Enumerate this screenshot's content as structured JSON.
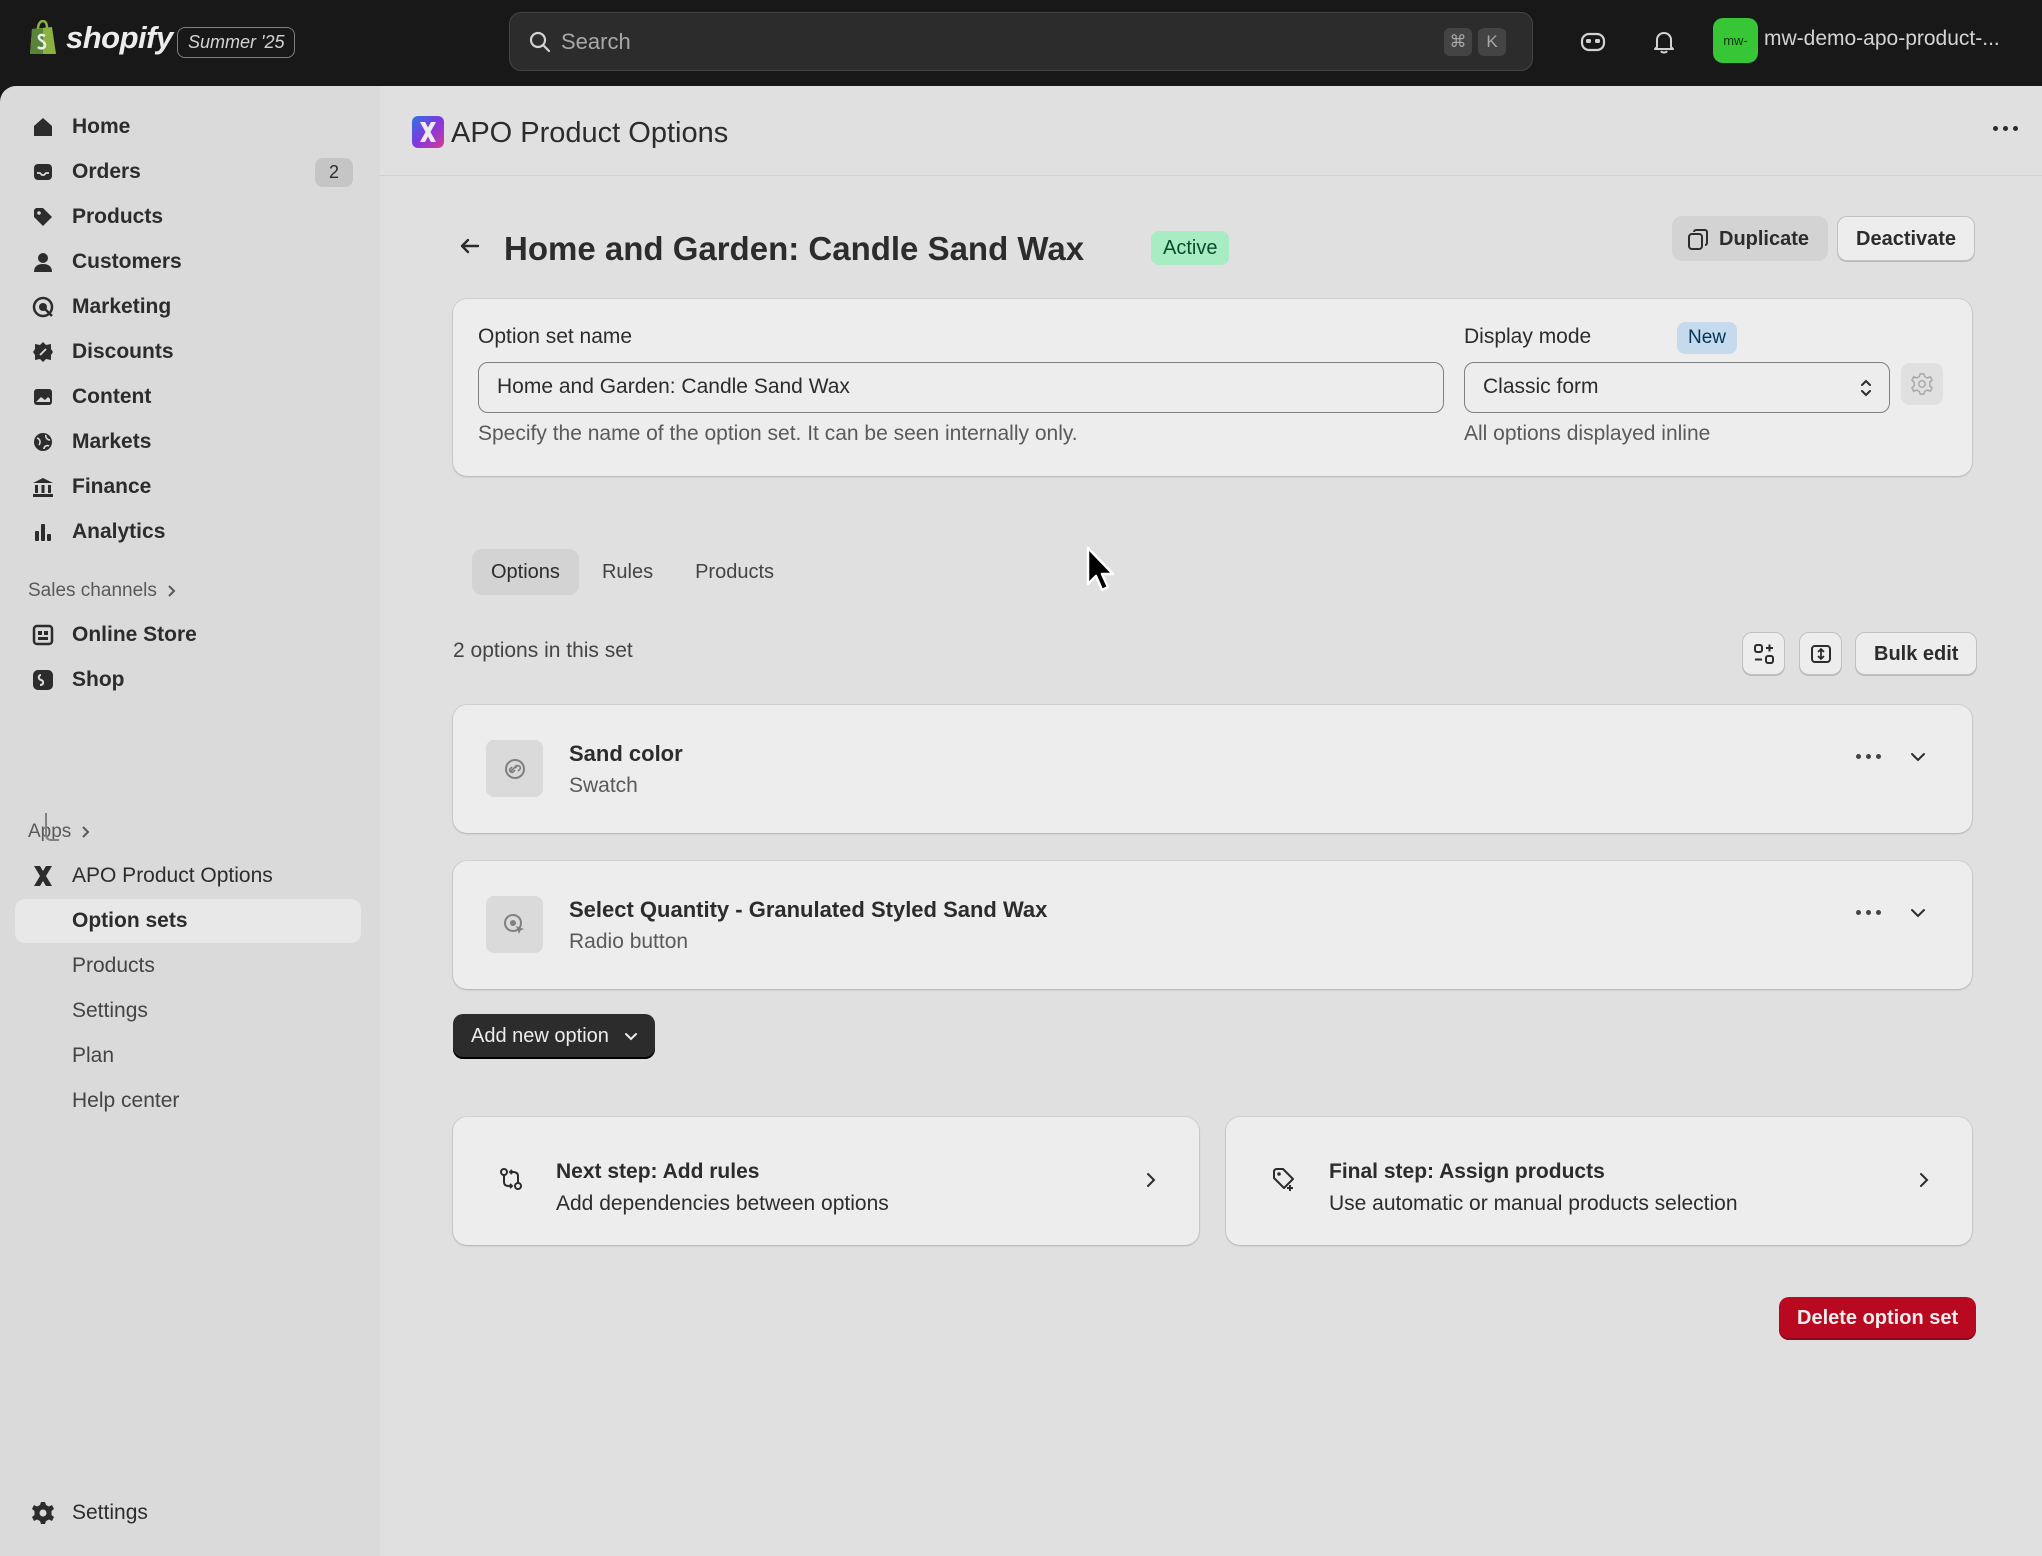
{
  "topbar": {
    "logo_text": "shopify",
    "edition": "Summer '25",
    "search_placeholder": "Search",
    "shortcut_keys": [
      "⌘",
      "K"
    ],
    "store_avatar": "mw-",
    "store_name": "mw-demo-apo-product-...",
    "avatar_color": "#3bd63b"
  },
  "sidebar": {
    "items": [
      {
        "label": "Home",
        "icon": "home-icon"
      },
      {
        "label": "Orders",
        "icon": "inbox-icon",
        "badge": "2"
      },
      {
        "label": "Products",
        "icon": "tag-icon"
      },
      {
        "label": "Customers",
        "icon": "person-icon"
      },
      {
        "label": "Marketing",
        "icon": "target-icon"
      },
      {
        "label": "Discounts",
        "icon": "discount-icon"
      },
      {
        "label": "Content",
        "icon": "image-icon"
      },
      {
        "label": "Markets",
        "icon": "globe-icon"
      },
      {
        "label": "Finance",
        "icon": "bank-icon"
      },
      {
        "label": "Analytics",
        "icon": "bar-chart-icon"
      }
    ],
    "sales_channels_label": "Sales channels",
    "channels": [
      {
        "label": "Online Store",
        "icon": "store-icon"
      },
      {
        "label": "Shop",
        "icon": "shop-icon"
      }
    ],
    "apps_label": "Apps",
    "app_name": "APO Product Options",
    "app_subitems": [
      "Option sets",
      "Products",
      "Settings",
      "Plan",
      "Help center"
    ],
    "settings_label": "Settings"
  },
  "app_header": {
    "title": "APO Product Options"
  },
  "page": {
    "title": "Home and Garden: Candle Sand Wax",
    "status": "Active",
    "duplicate_label": "Duplicate",
    "deactivate_label": "Deactivate"
  },
  "settings_card": {
    "name_label": "Option set name",
    "name_value": "Home and Garden: Candle Sand Wax",
    "name_help": "Specify the name of the option set. It can be seen internally only.",
    "display_mode_label": "Display mode",
    "new_badge": "New",
    "display_mode_value": "Classic form",
    "display_mode_help": "All options displayed inline"
  },
  "tabs": [
    "Options",
    "Rules",
    "Products"
  ],
  "options_section": {
    "count_text": "2 options in this set",
    "bulk_edit_label": "Bulk edit",
    "options": [
      {
        "title": "Sand color",
        "type": "Swatch",
        "icon": "link-icon"
      },
      {
        "title": "Select Quantity - Granulated Styled Sand Wax",
        "type": "Radio button",
        "icon": "radio-cursor-icon"
      }
    ],
    "add_label": "Add new option"
  },
  "steps": [
    {
      "title": "Next step: Add rules",
      "subtitle": "Add dependencies between options",
      "icon": "rules-icon"
    },
    {
      "title": "Final step: Assign products",
      "subtitle": "Use automatic or manual products selection",
      "icon": "tag-plus-icon"
    }
  ],
  "delete_label": "Delete option set",
  "colors": {
    "accent_dark": "#303030",
    "success_bg": "#b4fed2",
    "info_bg": "#d5ebff",
    "critical": "#c70a24"
  }
}
